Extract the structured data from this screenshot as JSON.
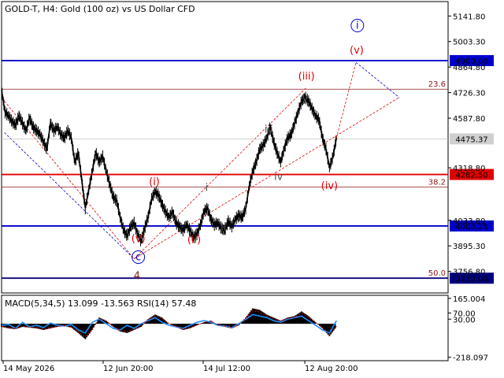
{
  "chart_data": {
    "type": "candlestick-line",
    "title": "GOLD-T, H4:  Gold (100 oz) vs US Dollar CFD",
    "x_ticks": [
      "14 May 2026",
      "12 Jun 20:00",
      "14 Jul 12:00",
      "12 Aug 20:00"
    ],
    "price_axis": {
      "range": [
        3640,
        5220
      ],
      "ticks": [
        "5141.80",
        "5003.30",
        "4864.80",
        "4726.30",
        "4587.80",
        "4318.80",
        "4033.80",
        "3895.30",
        "3756.80"
      ]
    },
    "levels": [
      {
        "value": 4900.0,
        "label": "4900.00",
        "color": "#0000cc",
        "kind": "support-resistance"
      },
      {
        "value": 4282.5,
        "label": "4282.50",
        "color": "#e00000",
        "kind": "support-resistance"
      },
      {
        "value": 4003.25,
        "label": "4003.25",
        "color": "#0000cc",
        "kind": "support-resistance"
      },
      {
        "value": 3720.0,
        "label": "3720.00",
        "color": "#000080",
        "kind": "support-resistance"
      },
      {
        "value": 4475.37,
        "label": "4475.37",
        "color": "#c0c0c0",
        "kind": "current-price"
      }
    ],
    "fibo": [
      {
        "value": 4745,
        "label": "23.6"
      },
      {
        "value": 4215,
        "label": "38.2"
      },
      {
        "value": 3722,
        "label": "50.0"
      }
    ],
    "price_series": [
      [
        0,
        4740
      ],
      [
        5,
        4620
      ],
      [
        10,
        4600
      ],
      [
        15,
        4570
      ],
      [
        20,
        4550
      ],
      [
        25,
        4600
      ],
      [
        30,
        4560
      ],
      [
        35,
        4520
      ],
      [
        40,
        4590
      ],
      [
        45,
        4540
      ],
      [
        50,
        4520
      ],
      [
        55,
        4500
      ],
      [
        60,
        4460
      ],
      [
        65,
        4420
      ],
      [
        70,
        4560
      ],
      [
        75,
        4520
      ],
      [
        80,
        4540
      ],
      [
        85,
        4500
      ],
      [
        90,
        4480
      ],
      [
        95,
        4520
      ],
      [
        100,
        4480
      ],
      [
        105,
        4350
      ],
      [
        110,
        4400
      ],
      [
        115,
        4250
      ],
      [
        120,
        4100
      ],
      [
        125,
        4200
      ],
      [
        130,
        4300
      ],
      [
        135,
        4400
      ],
      [
        140,
        4350
      ],
      [
        145,
        4380
      ],
      [
        150,
        4300
      ],
      [
        155,
        4230
      ],
      [
        160,
        4160
      ],
      [
        165,
        4140
      ],
      [
        170,
        4050
      ],
      [
        175,
        3980
      ],
      [
        180,
        3950
      ],
      [
        185,
        4000
      ],
      [
        190,
        4020
      ],
      [
        195,
        3960
      ],
      [
        200,
        3920
      ],
      [
        205,
        3990
      ],
      [
        210,
        4050
      ],
      [
        215,
        4150
      ],
      [
        220,
        4190
      ],
      [
        225,
        4170
      ],
      [
        230,
        4120
      ],
      [
        235,
        4080
      ],
      [
        240,
        4050
      ],
      [
        245,
        4080
      ],
      [
        250,
        4020
      ],
      [
        255,
        4000
      ],
      [
        260,
        3980
      ],
      [
        265,
        4010
      ],
      [
        270,
        3980
      ],
      [
        275,
        3940
      ],
      [
        280,
        3960
      ],
      [
        285,
        4010
      ],
      [
        290,
        4080
      ],
      [
        295,
        4100
      ],
      [
        300,
        4040
      ],
      [
        305,
        4010
      ],
      [
        310,
        4020
      ],
      [
        315,
        3990
      ],
      [
        320,
        3980
      ],
      [
        325,
        4030
      ],
      [
        330,
        4000
      ],
      [
        335,
        4040
      ],
      [
        340,
        4060
      ],
      [
        345,
        4050
      ],
      [
        350,
        4100
      ],
      [
        355,
        4220
      ],
      [
        360,
        4300
      ],
      [
        365,
        4350
      ],
      [
        370,
        4420
      ],
      [
        375,
        4440
      ],
      [
        380,
        4480
      ],
      [
        385,
        4540
      ],
      [
        390,
        4460
      ],
      [
        395,
        4400
      ],
      [
        400,
        4350
      ],
      [
        405,
        4420
      ],
      [
        410,
        4480
      ],
      [
        415,
        4500
      ],
      [
        420,
        4560
      ],
      [
        425,
        4620
      ],
      [
        430,
        4680
      ],
      [
        435,
        4700
      ],
      [
        440,
        4680
      ],
      [
        445,
        4640
      ],
      [
        450,
        4600
      ],
      [
        455,
        4580
      ],
      [
        460,
        4480
      ],
      [
        465,
        4420
      ],
      [
        470,
        4320
      ],
      [
        475,
        4380
      ],
      [
        480,
        4480
      ]
    ],
    "projection": [
      [
        480,
        4480
      ],
      [
        508,
        4890
      ],
      [
        570,
        4700
      ]
    ],
    "wave_labels": [
      {
        "text": "(i)",
        "x": 219,
        "y": 4226,
        "color": "#e00000"
      },
      {
        "text": "(ii)",
        "x": 276,
        "y": 3911,
        "color": "#e00000"
      },
      {
        "text": "(iii)",
        "x": 437,
        "y": 4798,
        "color": "#e00000"
      },
      {
        "text": "(iv)",
        "x": 470,
        "y": 4203,
        "color": "#e00000"
      },
      {
        "text": "(v)",
        "x": 509,
        "y": 4939,
        "color": "#e00000"
      },
      {
        "text": "(v)",
        "x": 196,
        "y": 3917,
        "color": "#e00000"
      },
      {
        "text": "i",
        "x": 294,
        "y": 4193,
        "color": "#555555"
      },
      {
        "text": "ii",
        "x": 318,
        "y": 3980,
        "color": "#555555"
      },
      {
        "text": "iii",
        "x": 383,
        "y": 4510,
        "color": "#555555"
      },
      {
        "text": "iv",
        "x": 397,
        "y": 4253,
        "color": "#555555"
      },
      {
        "text": "v",
        "x": 435,
        "y": 4680,
        "color": "#555555"
      },
      {
        "text": "4",
        "x": 194,
        "y": 3715,
        "color": "#8b1a1a"
      },
      {
        "text": "c",
        "x": 196,
        "y": 3817,
        "color": "#0000cc",
        "circled": true
      },
      {
        "text": "i",
        "x": 510,
        "y": 5073,
        "color": "#0000cc",
        "circled": true
      }
    ],
    "macd": {
      "label": "MACD(5,34,5) 13.099 -13.563 RSI(14) 57.48",
      "range": [
        -240,
        185
      ],
      "ticks": [
        "165.004",
        "70.00",
        "30.00",
        "-218.097"
      ],
      "histogram": [
        [
          0,
          -20
        ],
        [
          10,
          -30
        ],
        [
          20,
          -35
        ],
        [
          30,
          -20
        ],
        [
          40,
          -25
        ],
        [
          50,
          -30
        ],
        [
          60,
          -40
        ],
        [
          70,
          -30
        ],
        [
          80,
          -20
        ],
        [
          90,
          -15
        ],
        [
          100,
          -25
        ],
        [
          110,
          -60
        ],
        [
          120,
          -100
        ],
        [
          130,
          -40
        ],
        [
          140,
          40
        ],
        [
          150,
          20
        ],
        [
          160,
          -20
        ],
        [
          170,
          -50
        ],
        [
          180,
          -60
        ],
        [
          190,
          -40
        ],
        [
          200,
          -20
        ],
        [
          210,
          30
        ],
        [
          220,
          60
        ],
        [
          230,
          40
        ],
        [
          240,
          0
        ],
        [
          250,
          -20
        ],
        [
          260,
          -40
        ],
        [
          270,
          -30
        ],
        [
          280,
          -10
        ],
        [
          290,
          10
        ],
        [
          300,
          20
        ],
        [
          310,
          -10
        ],
        [
          320,
          -20
        ],
        [
          330,
          -30
        ],
        [
          340,
          -10
        ],
        [
          350,
          40
        ],
        [
          360,
          100
        ],
        [
          370,
          90
        ],
        [
          380,
          60
        ],
        [
          390,
          40
        ],
        [
          400,
          20
        ],
        [
          410,
          40
        ],
        [
          420,
          50
        ],
        [
          430,
          80
        ],
        [
          440,
          50
        ],
        [
          450,
          10
        ],
        [
          460,
          -30
        ],
        [
          470,
          -80
        ],
        [
          480,
          -20
        ]
      ],
      "rsi": [
        [
          0,
          -10
        ],
        [
          10,
          -5
        ],
        [
          20,
          -30
        ],
        [
          30,
          10
        ],
        [
          40,
          -20
        ],
        [
          50,
          -10
        ],
        [
          60,
          -25
        ],
        [
          70,
          5
        ],
        [
          80,
          -10
        ],
        [
          90,
          -15
        ],
        [
          100,
          -5
        ],
        [
          110,
          -40
        ],
        [
          120,
          -60
        ],
        [
          130,
          10
        ],
        [
          140,
          30
        ],
        [
          150,
          0
        ],
        [
          160,
          -30
        ],
        [
          170,
          -40
        ],
        [
          180,
          -10
        ],
        [
          190,
          -30
        ],
        [
          200,
          0
        ],
        [
          210,
          20
        ],
        [
          220,
          40
        ],
        [
          230,
          10
        ],
        [
          240,
          -10
        ],
        [
          250,
          -20
        ],
        [
          260,
          -30
        ],
        [
          270,
          -10
        ],
        [
          280,
          10
        ],
        [
          290,
          20
        ],
        [
          300,
          10
        ],
        [
          310,
          -10
        ],
        [
          320,
          -15
        ],
        [
          330,
          -25
        ],
        [
          340,
          0
        ],
        [
          350,
          30
        ],
        [
          360,
          60
        ],
        [
          370,
          50
        ],
        [
          380,
          40
        ],
        [
          390,
          20
        ],
        [
          400,
          10
        ],
        [
          410,
          30
        ],
        [
          420,
          40
        ],
        [
          430,
          50
        ],
        [
          440,
          20
        ],
        [
          450,
          -10
        ],
        [
          460,
          -40
        ],
        [
          470,
          -60
        ],
        [
          480,
          20
        ]
      ]
    }
  }
}
